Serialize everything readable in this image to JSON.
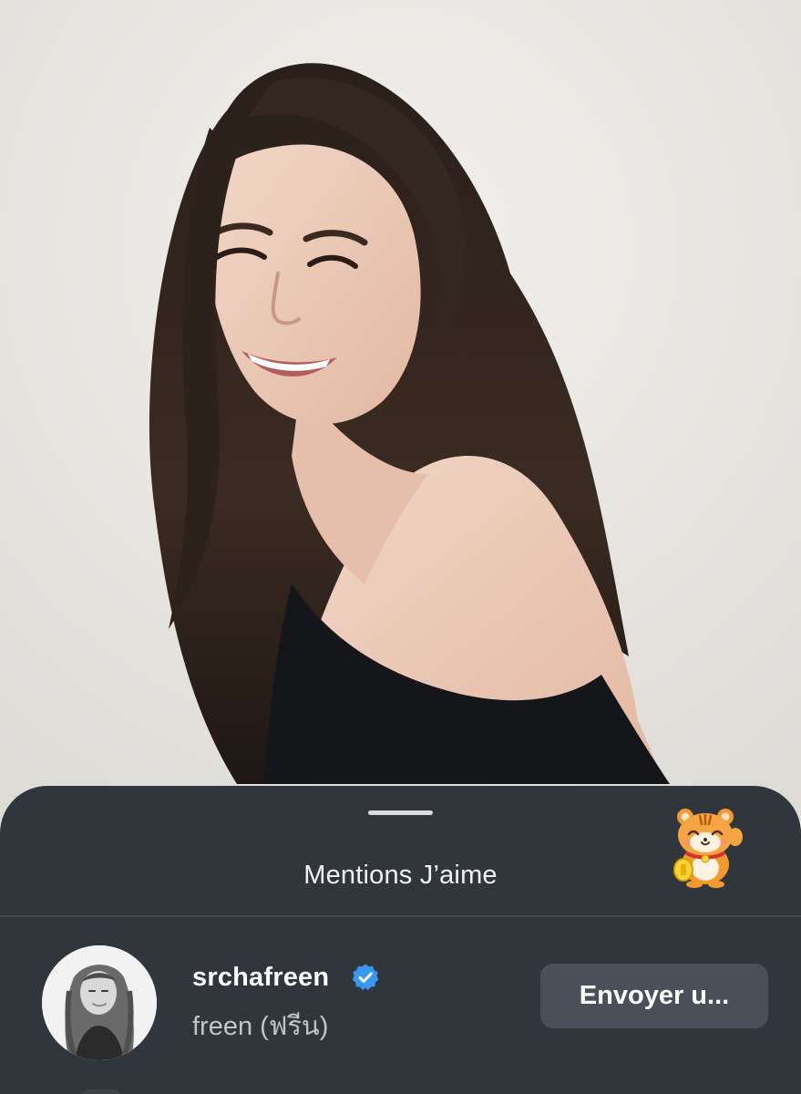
{
  "post": {
    "photo_icon": "portrait-photo"
  },
  "likes_sheet": {
    "title": "Mentions J’aime",
    "sticker_icon": "lucky-tiger-sticker",
    "users": [
      {
        "username": "srchafreen",
        "verified": true,
        "full_name": "freen (ฟรีน)",
        "action_label": "Envoyer u..."
      }
    ]
  },
  "colors": {
    "sheet_background": "#31363d",
    "button_background": "#4a5059",
    "verified_badge": "#3897f0"
  }
}
